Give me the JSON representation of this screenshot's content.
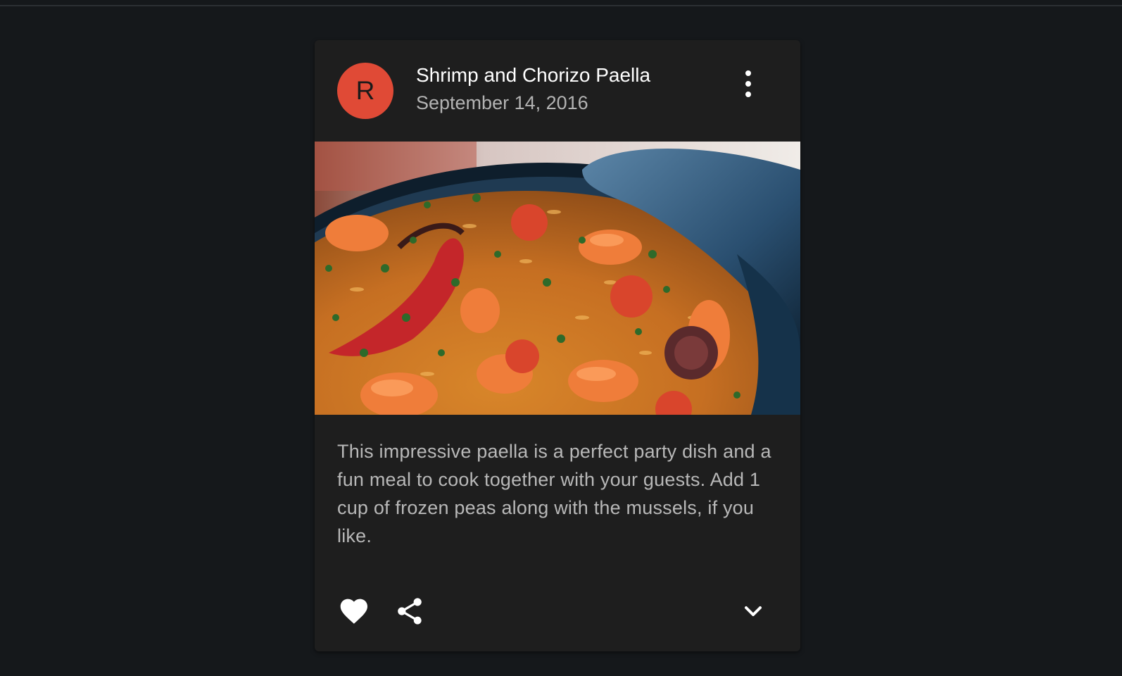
{
  "card": {
    "avatar_letter": "R",
    "title": "Shrimp and Chorizo Paella",
    "subheader": "September 14, 2016",
    "media_alt": "Paella dish",
    "description": "This impressive paella is a perfect party dish and a fun meal to cook together with your guests. Add 1 cup of frozen peas along with the mussels, if you like.",
    "actions": {
      "favorite_icon": "heart-icon",
      "share_icon": "share-icon",
      "expand_icon": "chevron-down-icon",
      "more_icon": "more-vert-icon"
    }
  },
  "colors": {
    "page_bg": "#15181b",
    "card_bg": "#1e1e1e",
    "avatar_bg": "#e04a36",
    "title": "#ffffff",
    "secondary_text": "#b3b3b3"
  }
}
